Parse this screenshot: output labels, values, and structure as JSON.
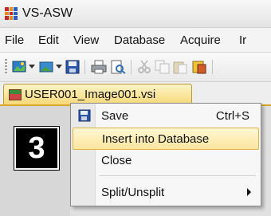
{
  "window": {
    "title": "VS-ASW"
  },
  "menu": [
    "File",
    "Edit",
    "View",
    "Database",
    "Acquire",
    "Ir"
  ],
  "document_tab": {
    "label": "USER001_Image001.vsi"
  },
  "step_badge": "3",
  "context_menu": {
    "items": [
      {
        "label": "Save",
        "shortcut": "Ctrl+S"
      },
      {
        "label": "Insert into Database"
      },
      {
        "label": "Close"
      },
      {
        "label": "Split/Unsplit"
      }
    ]
  },
  "colors": {
    "highlight": "#fbe6a0",
    "tab_active": "#f5d776"
  }
}
